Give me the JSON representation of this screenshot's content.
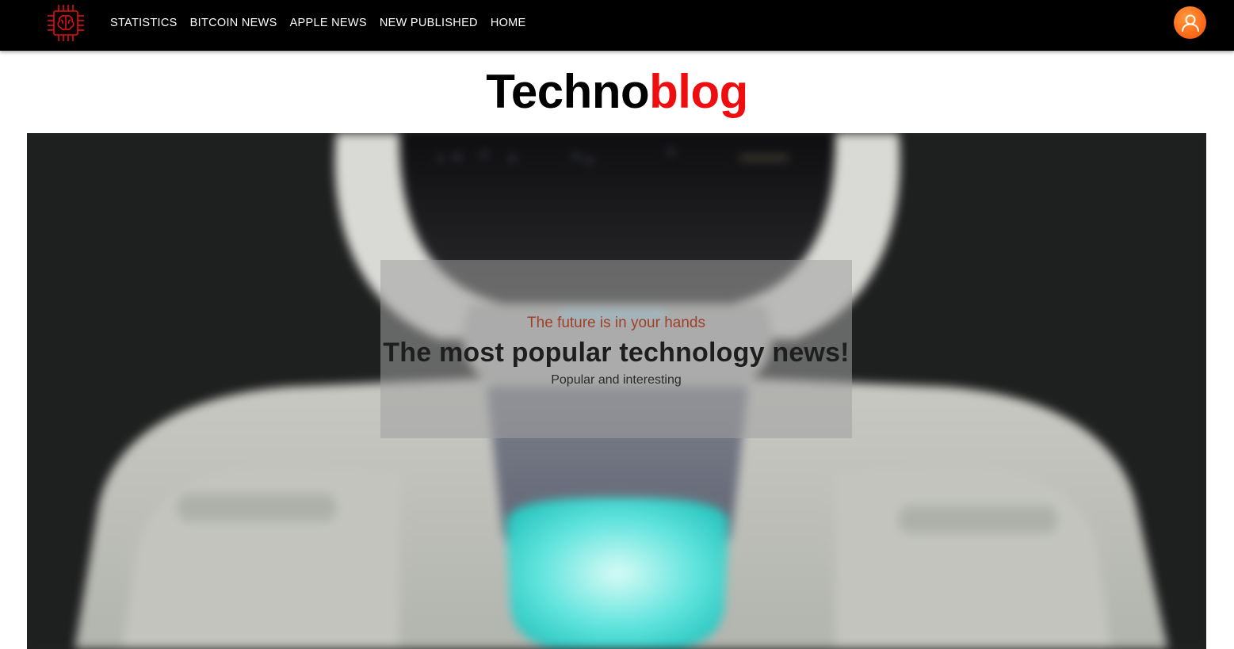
{
  "header": {
    "logo_icon": "brain-chip-icon",
    "nav": [
      {
        "label": "STATISTICS"
      },
      {
        "label": "BITCOIN NEWS"
      },
      {
        "label": "APPLE NEWS"
      },
      {
        "label": "NEW PUBLISHED"
      },
      {
        "label": "HOME"
      }
    ],
    "user_icon": "user-avatar-icon"
  },
  "site": {
    "title_part1": "Techno",
    "title_part2": "blog"
  },
  "hero": {
    "image_alt": "white humanoid robot close-up",
    "kicker": "The future is in your hands",
    "headline": "The most popular technology news!",
    "subtitle": "Popular and interesting"
  },
  "colors": {
    "header_bg": "#000000",
    "accent_red": "#ee0e10",
    "avatar_orange": "#ff6b1a",
    "kicker_red": "#a0402a"
  }
}
